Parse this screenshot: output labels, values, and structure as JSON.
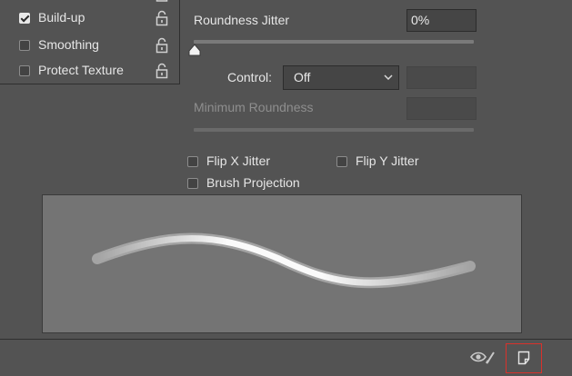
{
  "left_options": [
    {
      "label": "Build-up",
      "checked": true
    },
    {
      "label": "Smoothing",
      "checked": false
    },
    {
      "label": "Protect Texture",
      "checked": false
    }
  ],
  "roundness_jitter": {
    "label": "Roundness Jitter",
    "value": "0%",
    "slider_fraction": 0
  },
  "control": {
    "label": "Control:",
    "selected": "Off"
  },
  "minimum_roundness": {
    "label": "Minimum Roundness",
    "value": "",
    "enabled": false
  },
  "flip_x": {
    "label": "Flip X Jitter",
    "checked": false
  },
  "flip_y": {
    "label": "Flip Y Jitter",
    "checked": false
  },
  "brush_projection": {
    "label": "Brush Projection",
    "checked": false
  },
  "footer": {
    "eye_icon": "visibility-brush-icon",
    "new_icon": "new-brush-preset-icon",
    "highlight_color": "#d9312b"
  },
  "colors": {
    "panel_bg": "#535353",
    "preview_bg": "#747474",
    "stroke": "#ffffff"
  }
}
